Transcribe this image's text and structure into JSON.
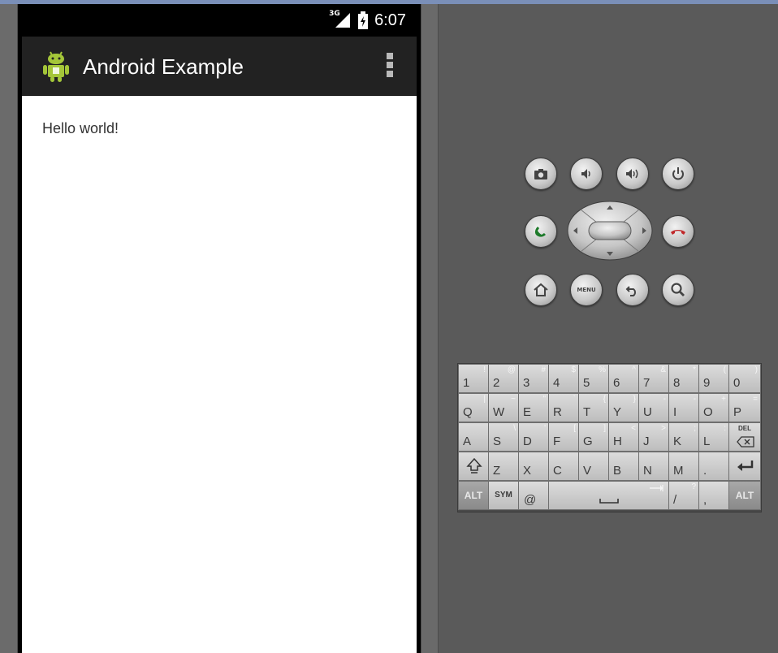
{
  "statusbar": {
    "network": "3G",
    "time": "6:07"
  },
  "actionbar": {
    "title": "Android Example"
  },
  "content": {
    "text": "Hello world!"
  },
  "hardware": {
    "row1": [
      "camera-icon",
      "volume-down-icon",
      "volume-up-icon",
      "power-icon"
    ],
    "row2": [
      "call-icon",
      "dpad",
      "end-call-icon"
    ],
    "row3": [
      "home-icon",
      "menu-icon",
      "back-icon",
      "search-icon"
    ],
    "menu_label": "MENU"
  },
  "keyboard": {
    "row1": [
      {
        "main": "1",
        "alt": "!"
      },
      {
        "main": "2",
        "alt": "@"
      },
      {
        "main": "3",
        "alt": "#"
      },
      {
        "main": "4",
        "alt": "$"
      },
      {
        "main": "5",
        "alt": "%"
      },
      {
        "main": "6",
        "alt": "^"
      },
      {
        "main": "7",
        "alt": "&"
      },
      {
        "main": "8",
        "alt": "*"
      },
      {
        "main": "9",
        "alt": "("
      },
      {
        "main": "0",
        "alt": ")"
      }
    ],
    "row2": [
      {
        "main": "Q",
        "alt": "|"
      },
      {
        "main": "W",
        "alt": "~"
      },
      {
        "main": "E",
        "alt": "\""
      },
      {
        "main": "R",
        "alt": "`"
      },
      {
        "main": "T",
        "alt": "{"
      },
      {
        "main": "Y",
        "alt": "}"
      },
      {
        "main": "U",
        "alt": "-"
      },
      {
        "main": "I",
        "alt": "-"
      },
      {
        "main": "O",
        "alt": "+"
      },
      {
        "main": "P",
        "alt": "="
      }
    ],
    "row3": [
      {
        "main": "A",
        "alt": ""
      },
      {
        "main": "S",
        "alt": "\\"
      },
      {
        "main": "D",
        "alt": "'"
      },
      {
        "main": "F",
        "alt": "["
      },
      {
        "main": "G",
        "alt": "]"
      },
      {
        "main": "H",
        "alt": "<"
      },
      {
        "main": "J",
        "alt": ">"
      },
      {
        "main": "K",
        "alt": ";"
      },
      {
        "main": "L",
        "alt": ":"
      }
    ],
    "del_label": "DEL",
    "row4": [
      {
        "main": "Z",
        "alt": ""
      },
      {
        "main": "X",
        "alt": ""
      },
      {
        "main": "C",
        "alt": ""
      },
      {
        "main": "V",
        "alt": ""
      },
      {
        "main": "B",
        "alt": ""
      },
      {
        "main": "N",
        "alt": ""
      },
      {
        "main": "M",
        "alt": ""
      },
      {
        "main": ".",
        "alt": ""
      }
    ],
    "row5": {
      "alt_left": "ALT",
      "sym": "SYM",
      "at": "@",
      "slash": "/",
      "slash_alt": "?",
      "comma": ",",
      "alt_right": "ALT"
    }
  },
  "colors": {
    "actionbar_bg": "#222222",
    "skin_bg": "#5a5a5a",
    "android_green": "#a4c639"
  }
}
